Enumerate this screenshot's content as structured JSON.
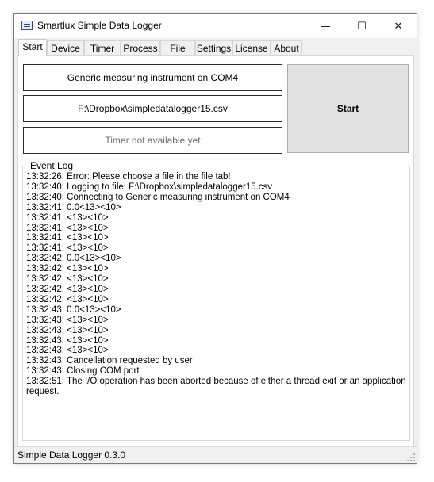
{
  "window": {
    "title": "Smartlux Simple Data Logger",
    "minimize_icon": "—",
    "maximize_icon": "☐",
    "close_icon": "✕"
  },
  "tabs": [
    {
      "label": "Start",
      "active": true
    },
    {
      "label": "Device"
    },
    {
      "label": "Timer"
    },
    {
      "label": "Process"
    },
    {
      "label": "File"
    },
    {
      "label": "Settings"
    },
    {
      "label": "License"
    },
    {
      "label": "About"
    }
  ],
  "start_panel": {
    "device_button": "Generic measuring instrument on COM4",
    "file_button": "F:\\Dropbox\\simpledatalogger15.csv",
    "timer_button": "Timer not available yet",
    "start_button": "Start"
  },
  "event_log": {
    "title": "Event Log",
    "lines": [
      "13:32:26: Error: Please choose a file in the file tab!",
      "13:32:40: Logging to file: F:\\Dropbox\\simpledatalogger15.csv",
      "13:32:40: Connecting to Generic measuring instrument on COM4",
      "13:32:41: 0.0<13><10>",
      "13:32:41: <13><10>",
      "13:32:41: <13><10>",
      "13:32:41: <13><10>",
      "13:32:41: <13><10>",
      "13:32:42: 0.0<13><10>",
      "13:32:42: <13><10>",
      "13:32:42: <13><10>",
      "13:32:42: <13><10>",
      "13:32:42: <13><10>",
      "13:32:43: 0.0<13><10>",
      "13:32:43: <13><10>",
      "13:32:43: <13><10>",
      "13:32:43: <13><10>",
      "13:32:43: <13><10>",
      "13:32:43: Cancellation requested by user",
      "13:32:43: Closing COM port",
      "13:32:51: The I/O operation has been aborted because of either a thread exit or an application request."
    ]
  },
  "status_bar": {
    "text": "Simple Data Logger 0.3.0"
  }
}
